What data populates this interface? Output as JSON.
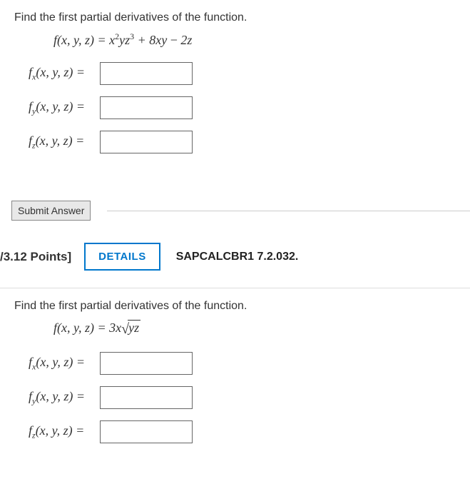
{
  "q1": {
    "instruction": "Find the first partial derivatives of the function.",
    "equation_html": "f(x, y, z) = x<sup>2</sup>yz<sup>3</sup> + 8xy <span class='minus'>−</span> 2z",
    "rows": [
      {
        "label_html": "f<sub>x</sub>(x, y, z) ="
      },
      {
        "label_html": "f<sub>y</sub>(x, y, z) ="
      },
      {
        "label_html": "f<sub>z</sub>(x, y, z) ="
      }
    ],
    "submit_label": "Submit Answer"
  },
  "header": {
    "points": "/3.12 Points]",
    "details_label": "DETAILS",
    "book_ref": "SAPCALCBR1 7.2.032."
  },
  "q2": {
    "instruction": "Find the first partial derivatives of the function.",
    "equation_html": "f(x, y, z) = 3x<span class='sqrt'><span class='sqrt-symbol'>√</span><span class='sqrt-content'>yz</span></span>",
    "rows": [
      {
        "label_html": "f<sub>x</sub>(x, y, z) ="
      },
      {
        "label_html": "f<sub>y</sub>(x, y, z) ="
      },
      {
        "label_html": "f<sub>z</sub>(x, y, z) ="
      }
    ]
  }
}
